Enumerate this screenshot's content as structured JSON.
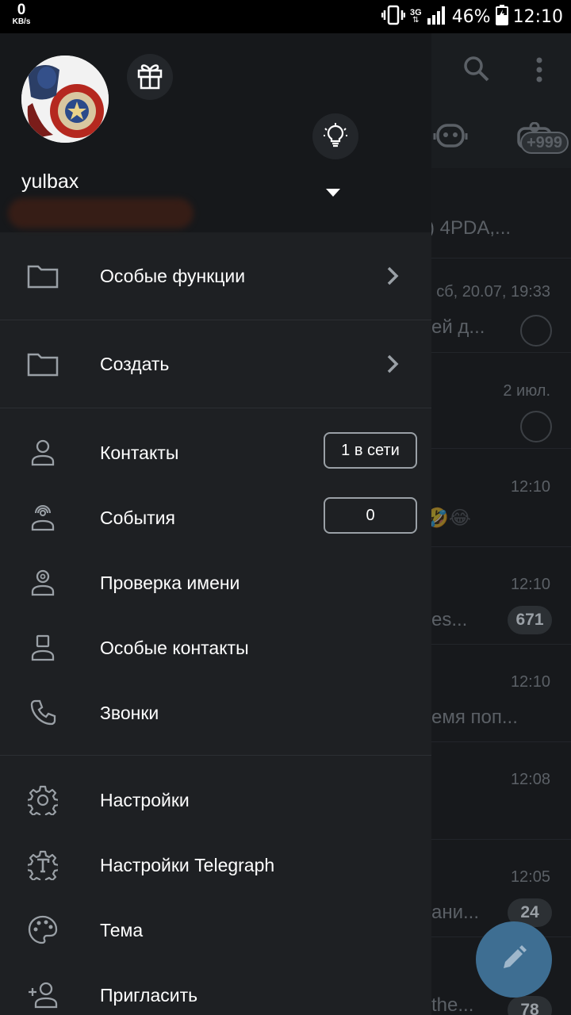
{
  "status_bar": {
    "speed_value": "0",
    "speed_unit": "KB/s",
    "network": "3G",
    "battery": "46%",
    "time": "12:10"
  },
  "profile": {
    "username": "yulbax"
  },
  "menu": {
    "special_functions": "Особые функции",
    "create": "Создать",
    "contacts": "Контакты",
    "contacts_badge": "1 в сети",
    "events": "События",
    "events_badge": "0",
    "username_check": "Проверка имени",
    "special_contacts": "Особые контакты",
    "calls": "Звонки",
    "settings": "Настройки",
    "telegraph_settings": "Настройки Telegraph",
    "theme": "Тема",
    "invite": "Пригласить"
  },
  "background": {
    "tab_badge": "+999",
    "rows": [
      {
        "time": "",
        "snippet": ") 4PDA,..."
      },
      {
        "time": "сб, 20.07, 19:33",
        "snippet": "ей д..."
      },
      {
        "time": "2 июл.",
        "snippet": ""
      },
      {
        "time": "12:10",
        "snippet": "🤣😂"
      },
      {
        "time": "12:10",
        "snippet": "es...",
        "badge": "671"
      },
      {
        "time": "12:10",
        "snippet": "емя поп..."
      },
      {
        "time": "12:08",
        "snippet": ""
      },
      {
        "time": "12:05",
        "snippet": "ани...",
        "badge": "24"
      },
      {
        "time": "",
        "snippet": "the...",
        "badge": "78"
      }
    ]
  },
  "colors": {
    "drawer_bg": "#1e2023",
    "header_bg": "#16181b",
    "fab": "#3e6e92"
  }
}
